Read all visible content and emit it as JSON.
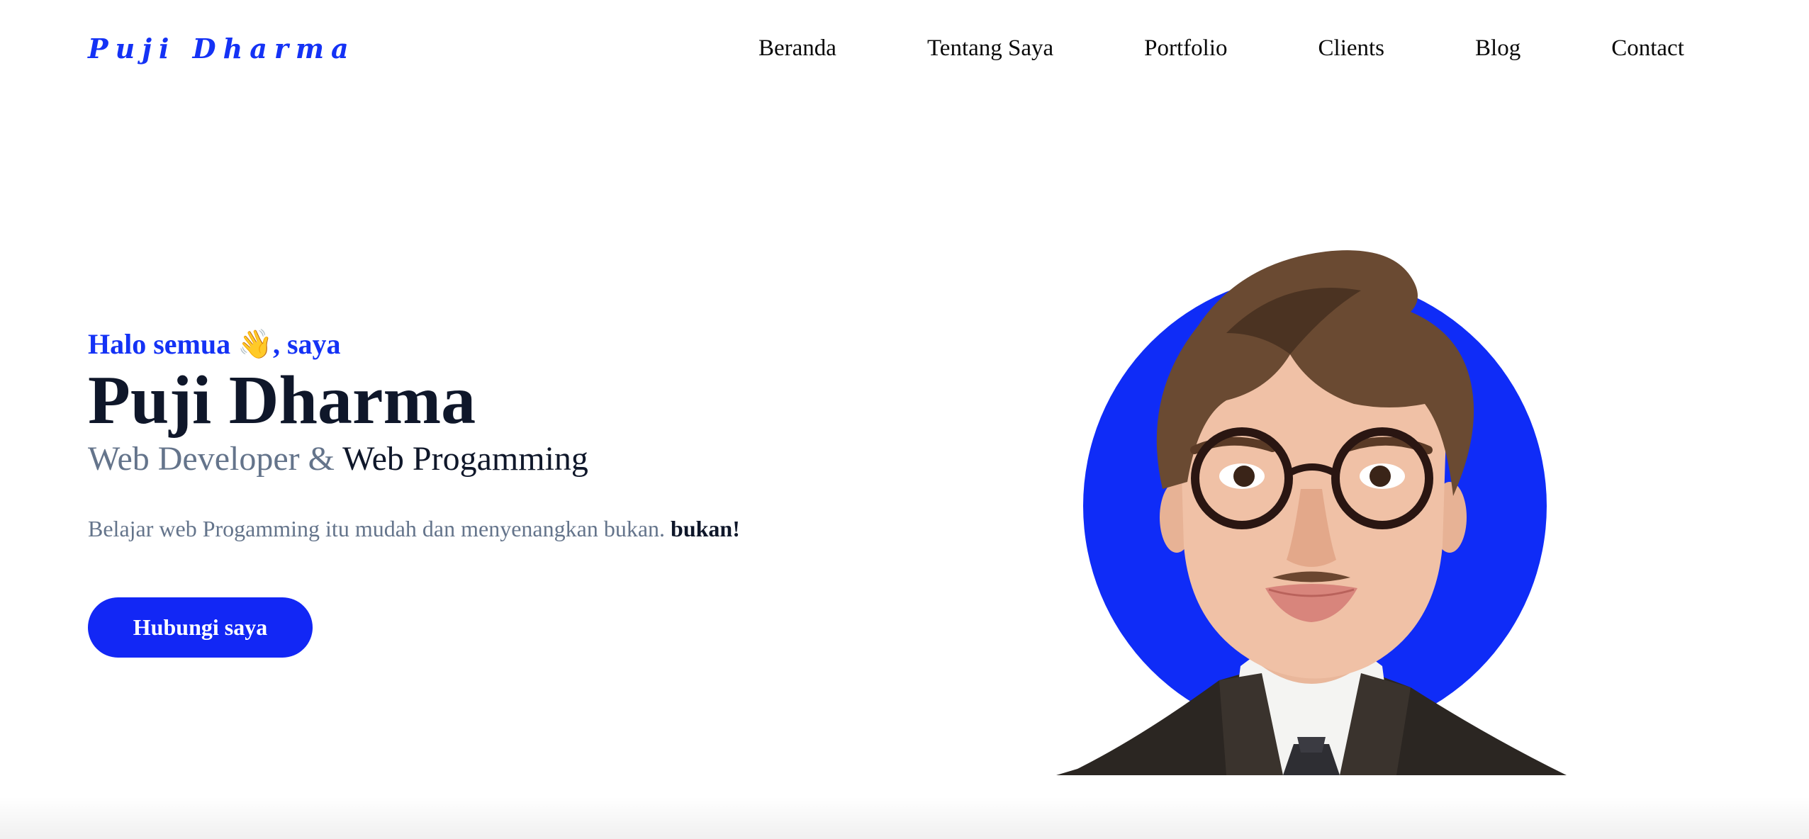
{
  "header": {
    "logo": "Puji Dharma",
    "nav": [
      "Beranda",
      "Tentang Saya",
      "Portfolio",
      "Clients",
      "Blog",
      "Contact"
    ]
  },
  "hero": {
    "greeting_text": "Halo semua",
    "greeting_emoji": "👋",
    "greeting_suffix": ", saya",
    "name": "Puji Dharma",
    "role_part1": "Web Developer &",
    "role_part2": "Web Progamming",
    "description": "Belajar web Progamming itu mudah dan menyenangkan bukan.",
    "description_bold": "bukan!",
    "cta_label": "Hubungi saya"
  },
  "colors": {
    "accent": "#1432f5",
    "dark": "#0f172a",
    "muted": "#64748b"
  }
}
